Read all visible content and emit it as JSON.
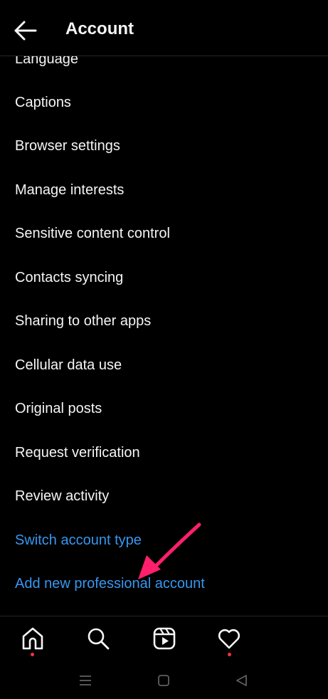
{
  "header": {
    "title": "Account",
    "back_icon": "arrow-left-icon"
  },
  "items": [
    {
      "label": "Language",
      "color": "#f5f5f5"
    },
    {
      "label": "Captions",
      "color": "#f5f5f5"
    },
    {
      "label": "Browser settings",
      "color": "#f5f5f5"
    },
    {
      "label": "Manage interests",
      "color": "#f5f5f5"
    },
    {
      "label": "Sensitive content control",
      "color": "#f5f5f5"
    },
    {
      "label": "Contacts syncing",
      "color": "#f5f5f5"
    },
    {
      "label": "Sharing to other apps",
      "color": "#f5f5f5"
    },
    {
      "label": "Cellular data use",
      "color": "#f5f5f5"
    },
    {
      "label": "Original posts",
      "color": "#f5f5f5"
    },
    {
      "label": "Request verification",
      "color": "#f5f5f5"
    },
    {
      "label": "Review activity",
      "color": "#f5f5f5"
    },
    {
      "label": "Switch account type",
      "color": "#3797f0"
    },
    {
      "label": "Add new professional account",
      "color": "#3797f0"
    }
  ],
  "annotation": {
    "icon": "pointer-arrow-icon",
    "color": "#ff1f6d"
  },
  "tabbar": {
    "tabs": [
      "home-icon",
      "search-icon",
      "reels-icon",
      "heart-icon"
    ],
    "notification_color": "#ff3040"
  },
  "system_nav": [
    "menu-icon",
    "home-square-icon",
    "back-triangle-icon"
  ],
  "colors": {
    "background": "#000000",
    "text": "#f5f5f5",
    "link": "#3797f0",
    "divider": "#262626"
  }
}
